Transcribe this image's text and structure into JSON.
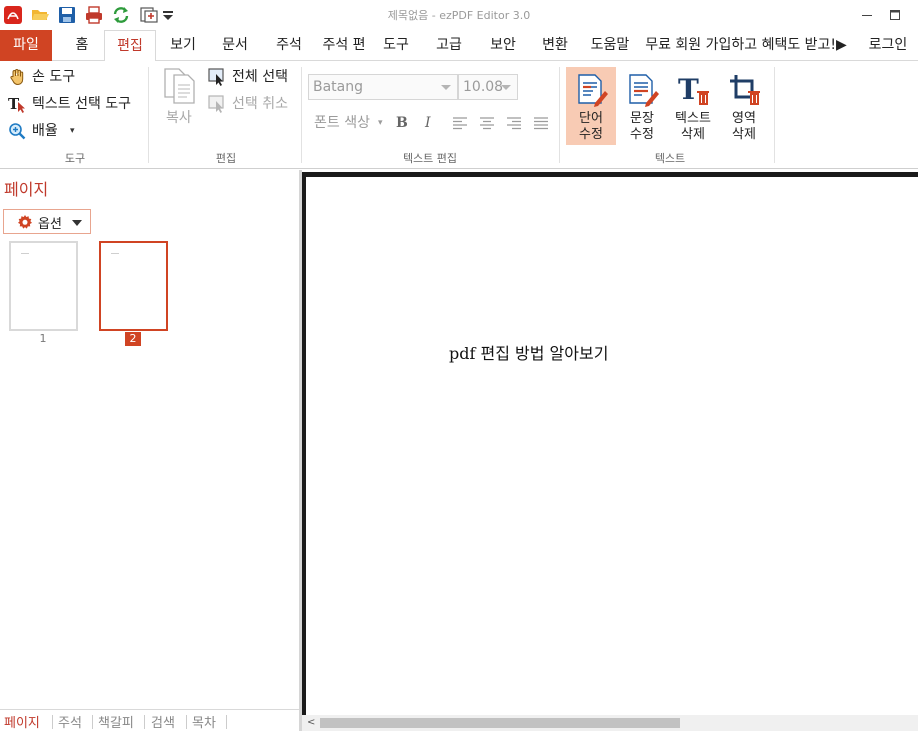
{
  "window": {
    "title": "제목없음 - ezPDF Editor 3.0",
    "quick_access": [
      "acrobat-icon",
      "open-folder-icon",
      "save-icon",
      "print-icon",
      "refresh-icon",
      "page-arrange-icon",
      "dropdown-icon"
    ]
  },
  "menu": {
    "file": "파일",
    "tabs": [
      "홈",
      "편집",
      "보기",
      "문서",
      "주석",
      "주석 편",
      "도구",
      "고급",
      "보안",
      "변환",
      "도움말"
    ],
    "active_tab": "편집",
    "promo": "무료 회원 가입하고 혜택도 받고!▶",
    "login": "로그인"
  },
  "ribbon": {
    "tools": {
      "hand": "손 도구",
      "text_select": "텍스트 선택 도구",
      "zoom": "배율",
      "group_label": "도구"
    },
    "edit": {
      "copy": "복사",
      "select_all": "전체 선택",
      "deselect": "선택 취소",
      "group_label": "편집"
    },
    "text_edit": {
      "font": "Batang",
      "size": "10.08",
      "font_color": "폰트 색상",
      "bold": "B",
      "italic": "I",
      "group_label": "텍스트 편집"
    },
    "text": {
      "word_edit_1": "단어",
      "word_edit_2": "수정",
      "sentence_edit_1": "문장",
      "sentence_edit_2": "수정",
      "text_delete_1": "텍스트",
      "text_delete_2": "삭제",
      "area_delete_1": "영역",
      "area_delete_2": "삭제",
      "group_label": "텍스트"
    }
  },
  "sidebar": {
    "title": "페이지",
    "options_label": "옵션",
    "pages": [
      "1",
      "2"
    ],
    "selected_page": "2",
    "bottom_tabs": [
      "페이지",
      "주석",
      "책갈피",
      "검색",
      "목차"
    ]
  },
  "document": {
    "text": "pdf 편집 방법 알아보기"
  },
  "colors": {
    "accent": "#d04423",
    "active_button_bg": "#f8cbb4"
  }
}
